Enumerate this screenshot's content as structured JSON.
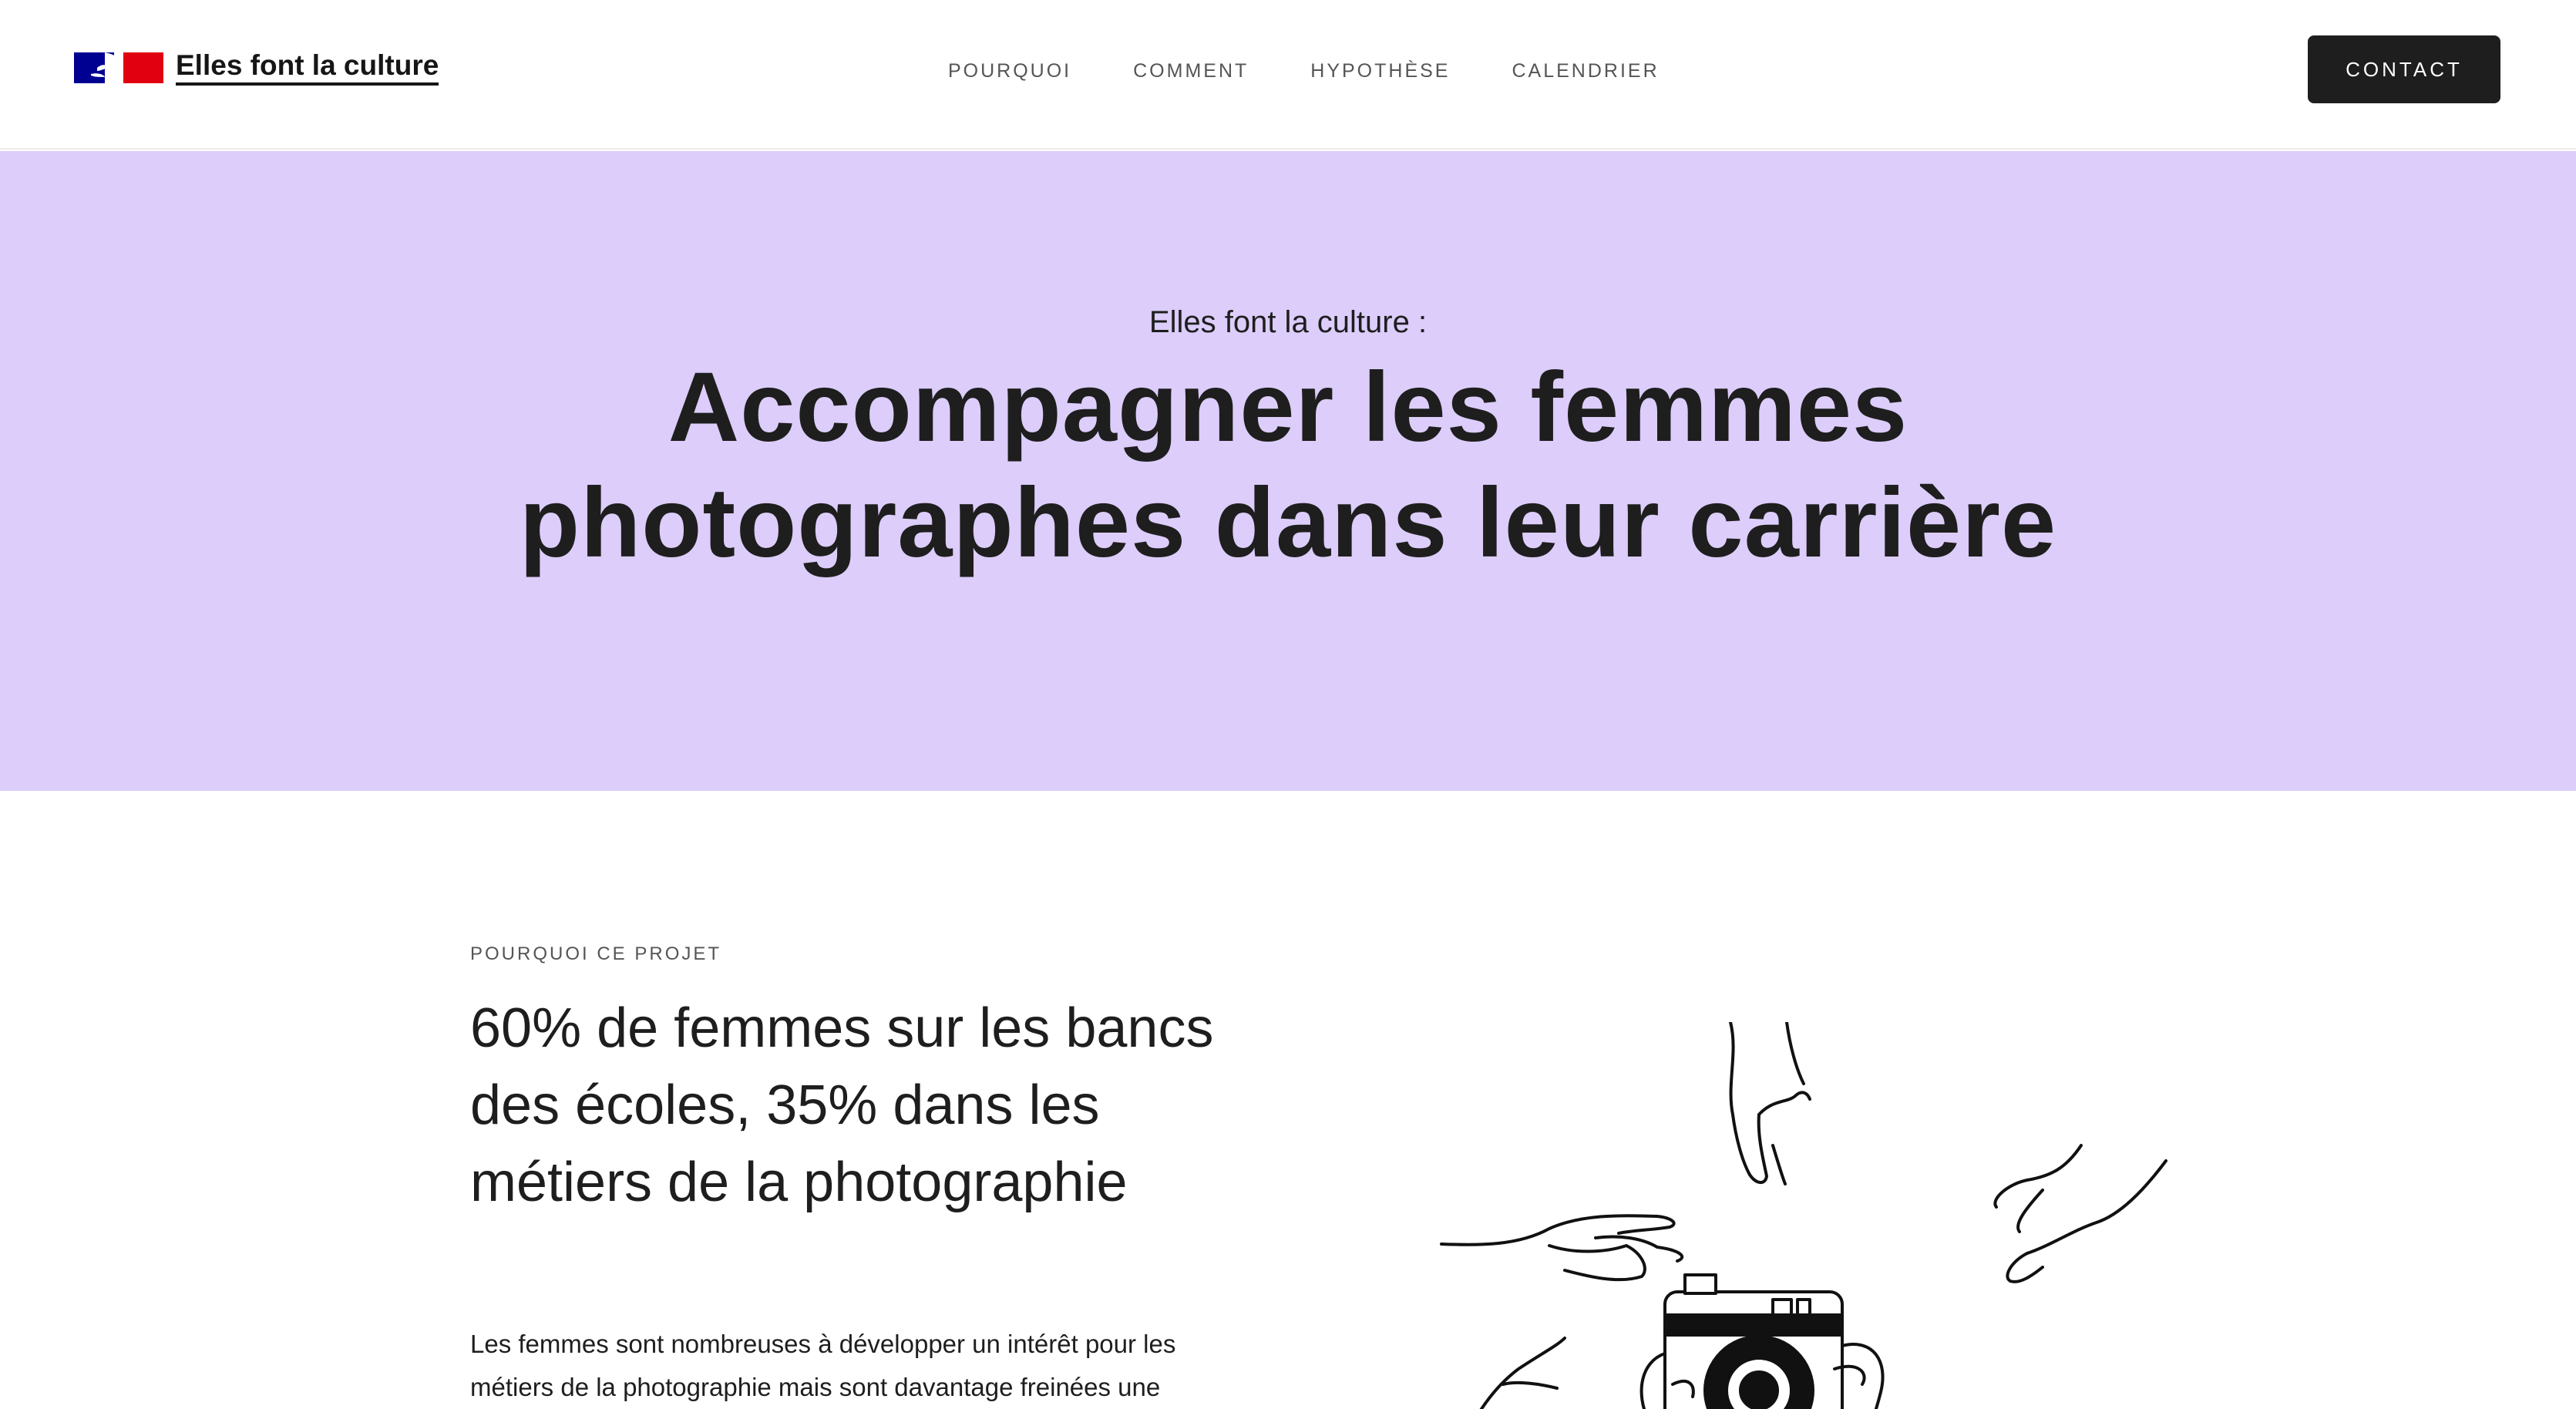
{
  "header": {
    "brand_name": "Elles font la culture",
    "logo_icon": "marianne-flag-icon",
    "nav": [
      {
        "label": "POURQUOI"
      },
      {
        "label": "COMMENT"
      },
      {
        "label": "HYPOTHÈSE"
      },
      {
        "label": "CALENDRIER"
      }
    ],
    "contact_label": "CONTACT"
  },
  "hero": {
    "kicker": "Elles font la culture :",
    "title": "Accompagner les femmes photographes dans leur carrière",
    "background": "#dccdfa"
  },
  "section": {
    "eyebrow": "POURQUOI CE PROJET",
    "title": "60% de femmes sur les bancs des écoles, 35% dans les métiers de la photographie",
    "text": "Les femmes sont nombreuses à développer un intérêt pour les métiers de la photographie mais sont davantage freinées une",
    "illustration_icon": "hands-camera-illustration"
  },
  "colors": {
    "accent": "#dccdfa",
    "button_bg": "#1e1e1e",
    "text": "#1e1e1e",
    "flag_blue": "#000091",
    "flag_red": "#e1000f"
  }
}
